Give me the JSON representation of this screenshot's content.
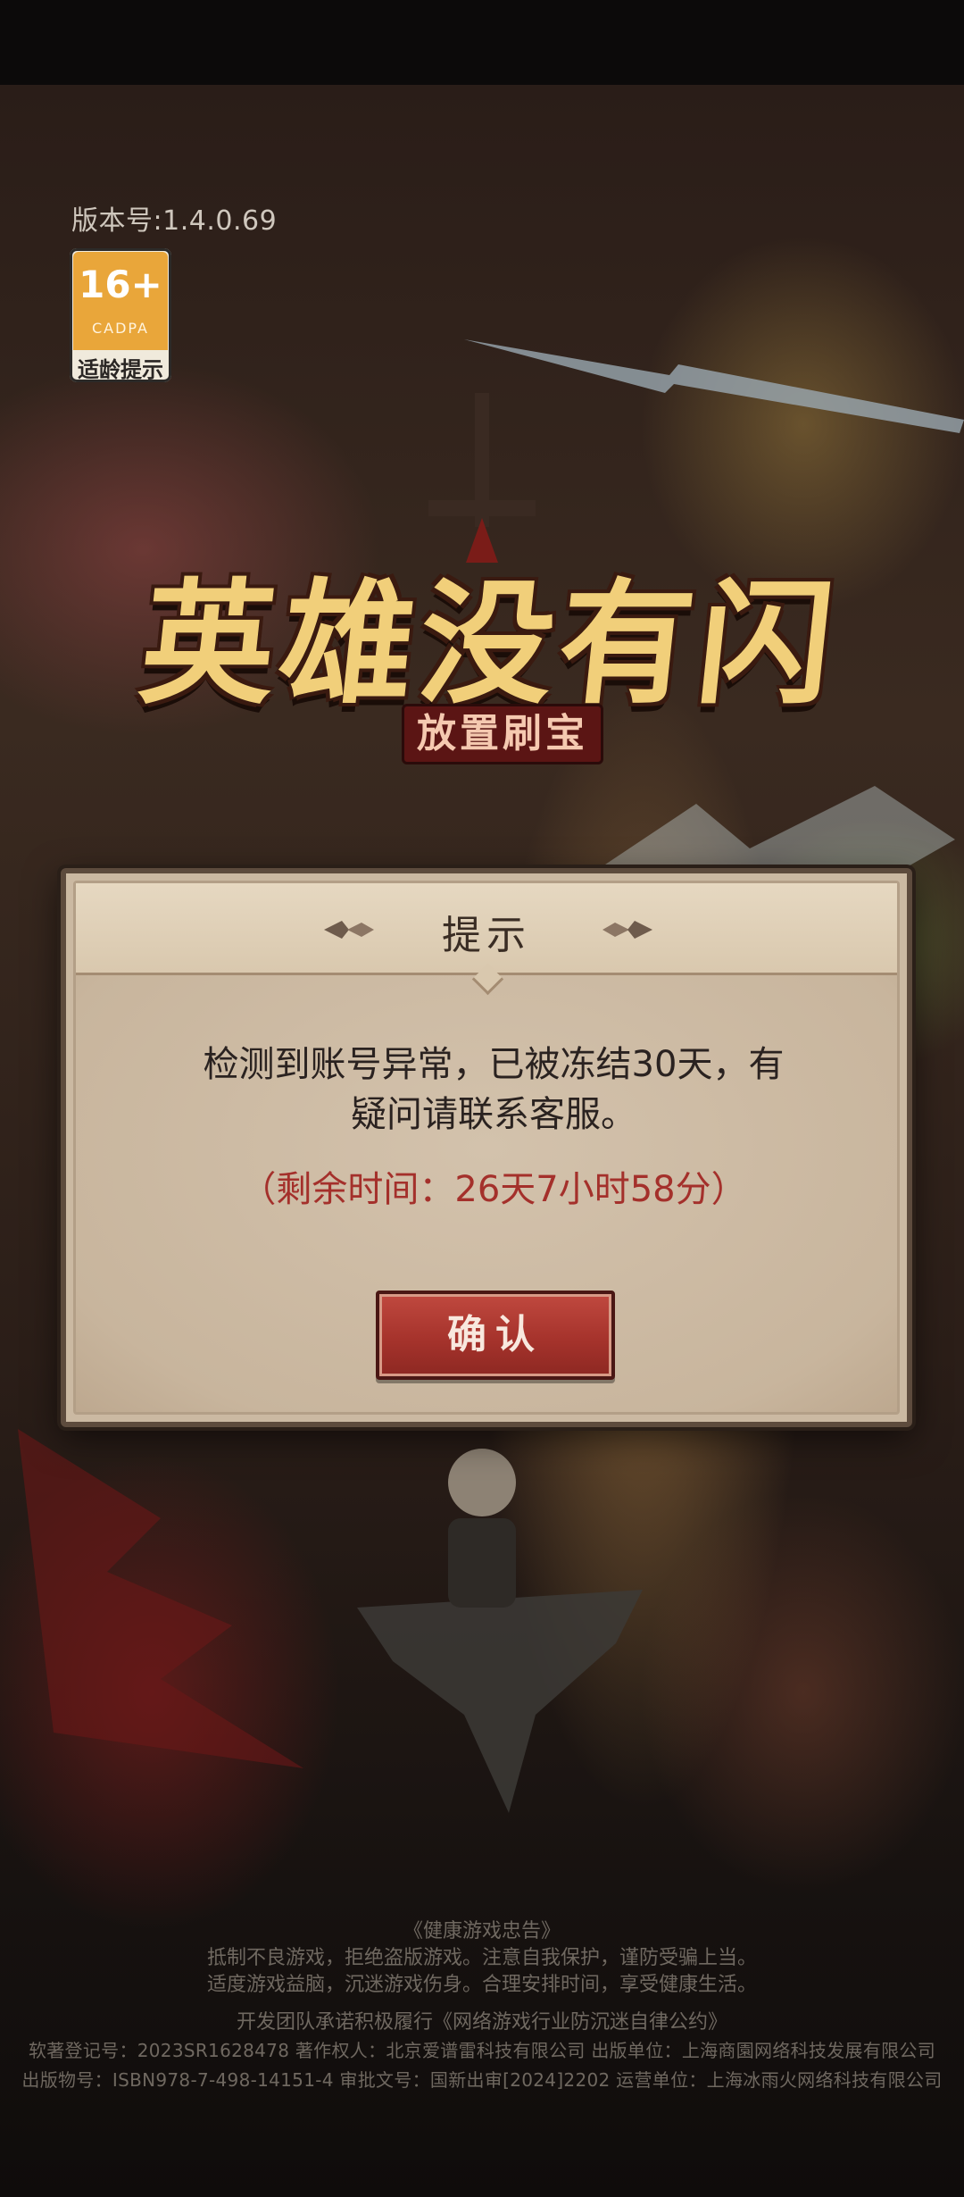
{
  "app": {
    "version_text": "版本号:1.4.0.69",
    "age_badge": {
      "rating": "16+",
      "org": "CADPA",
      "tip": "适龄提示"
    },
    "logo": {
      "title": "英雄没有闪",
      "subtitle": "放置刷宝"
    }
  },
  "dialog": {
    "title": "提示",
    "message_line1": "检测到账号异常，已被冻结30天，有",
    "message_line2": "疑问请联系客服。",
    "remaining": "（剩余时间：26天7小时58分）",
    "confirm_label": "确认"
  },
  "footer": {
    "health_title": "《健康游戏忠告》",
    "health_line1": "抵制不良游戏，拒绝盗版游戏。注意自我保护，谨防受骗上当。",
    "health_line2": "适度游戏益脑，沉迷游戏伤身。合理安排时间，享受健康生活。",
    "pledge": "开发团队承诺积极履行《网络游戏行业防沉迷自律公约》",
    "copyright_line": "软著登记号：2023SR1628478  著作权人：北京爱谱雷科技有限公司  出版单位：上海商園网络科技发展有限公司",
    "publish_line": "出版物号：ISBN978-7-498-14151-4  审批文号：国新出审[2024]2202  运营单位：上海冰雨火网络科技有限公司"
  },
  "colors": {
    "dialog_bg": "#cbb9a2",
    "remaining_text": "#a4302b",
    "confirm_button": "#a6332c",
    "logo_gold": "#f1cf7a"
  }
}
